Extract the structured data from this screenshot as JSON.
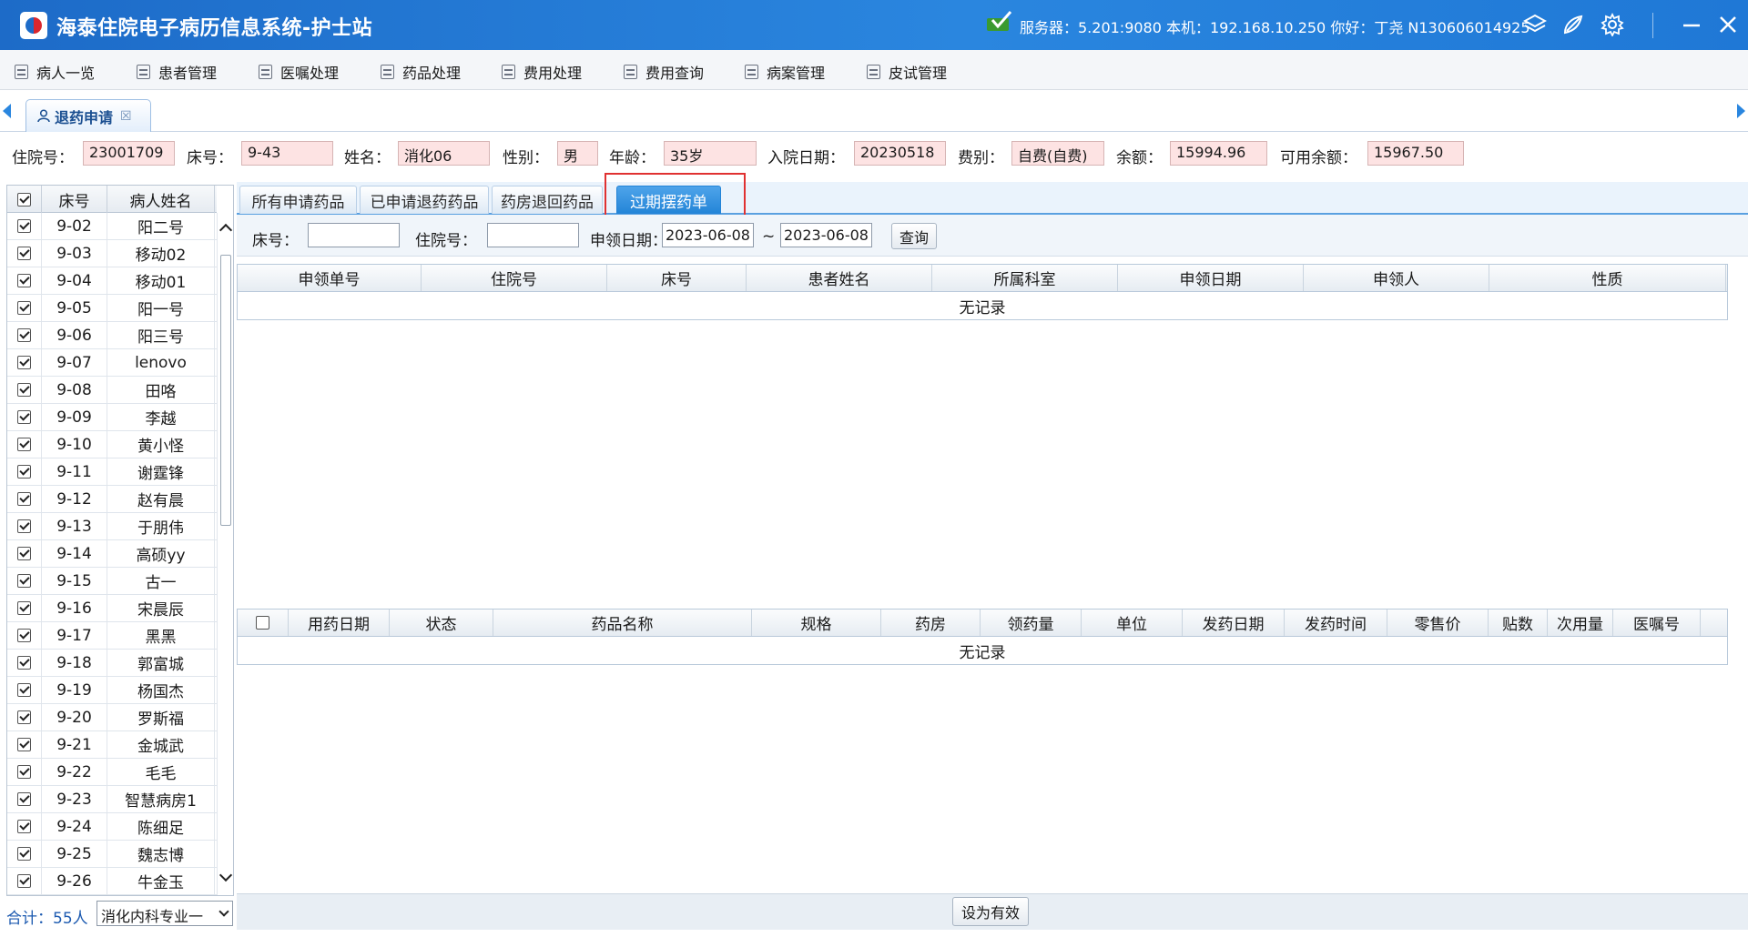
{
  "app": {
    "title": "海泰住院电子病历信息系统-护士站",
    "server_info": "服务器：5.201:9080  本机：192.168.10.250  你好：丁尧 N130606014925"
  },
  "menu": [
    {
      "label": "病人一览"
    },
    {
      "label": "患者管理"
    },
    {
      "label": "医嘱处理"
    },
    {
      "label": "药品处理"
    },
    {
      "label": "费用处理"
    },
    {
      "label": "费用查询"
    },
    {
      "label": "病案管理"
    },
    {
      "label": "皮试管理"
    }
  ],
  "doc_tab": {
    "label": "退药申请",
    "close": "☒"
  },
  "patient": {
    "admission_no_label": "住院号：",
    "admission_no": "23001709",
    "bed_label": "床号：",
    "bed": "9-43",
    "name_label": "姓名：",
    "name": "消化06",
    "gender_label": "性别：",
    "gender": "男",
    "age_label": "年龄：",
    "age": "35岁",
    "admit_date_label": "入院日期：",
    "admit_date": "20230518",
    "fee_type_label": "费别：",
    "fee_type": "自费(自费)",
    "balance_label": "余额：",
    "balance": "15994.96",
    "available_label": "可用余额：",
    "available": "15967.50"
  },
  "patient_list": {
    "headers": {
      "bed": "床号",
      "name": "病人姓名"
    },
    "rows": [
      {
        "bed": "9-02",
        "name": "阳二号"
      },
      {
        "bed": "9-03",
        "name": "移动02"
      },
      {
        "bed": "9-04",
        "name": "移动01"
      },
      {
        "bed": "9-05",
        "name": "阳一号"
      },
      {
        "bed": "9-06",
        "name": "阳三号"
      },
      {
        "bed": "9-07",
        "name": "lenovo"
      },
      {
        "bed": "9-08",
        "name": "田咯"
      },
      {
        "bed": "9-09",
        "name": "李越"
      },
      {
        "bed": "9-10",
        "name": "黄小怪"
      },
      {
        "bed": "9-11",
        "name": "谢霆锋"
      },
      {
        "bed": "9-12",
        "name": "赵有晨"
      },
      {
        "bed": "9-13",
        "name": "于朋伟"
      },
      {
        "bed": "9-14",
        "name": "高硕yy"
      },
      {
        "bed": "9-15",
        "name": "古一"
      },
      {
        "bed": "9-16",
        "name": "宋晨辰"
      },
      {
        "bed": "9-17",
        "name": "黑黑"
      },
      {
        "bed": "9-18",
        "name": "郭富城"
      },
      {
        "bed": "9-19",
        "name": "杨国杰"
      },
      {
        "bed": "9-20",
        "name": "罗斯福"
      },
      {
        "bed": "9-21",
        "name": "金城武"
      },
      {
        "bed": "9-22",
        "name": "毛毛"
      },
      {
        "bed": "9-23",
        "name": "智慧病房1"
      },
      {
        "bed": "9-24",
        "name": "陈细足"
      },
      {
        "bed": "9-25",
        "name": "魏志博"
      },
      {
        "bed": "9-26",
        "name": "牛金玉"
      }
    ],
    "total": "合计：55人",
    "dept": "消化内科专业一"
  },
  "sub_tabs": [
    {
      "label": "所有申请药品",
      "active": false
    },
    {
      "label": "已申请退药药品",
      "active": false
    },
    {
      "label": "药房退回药品",
      "active": false
    },
    {
      "label": "过期摆药单",
      "active": true
    }
  ],
  "filter": {
    "bed_label": "床号：",
    "bed_value": "",
    "admission_label": "住院号：",
    "admission_value": "",
    "date_label": "申领日期：",
    "date_from": "2023-06-08",
    "date_sep": "~",
    "date_to": "2023-06-08",
    "query_button": "查询"
  },
  "top_grid": {
    "columns": [
      "申领单号",
      "住院号",
      "床号",
      "患者姓名",
      "所属科室",
      "申领日期",
      "申领人",
      "性质"
    ],
    "empty_text": "无记录"
  },
  "bottom_grid": {
    "columns": [
      "用药日期",
      "状态",
      "药品名称",
      "规格",
      "药房",
      "领药量",
      "单位",
      "发药日期",
      "发药时间",
      "零售价",
      "贴数",
      "次用量",
      "医嘱号"
    ],
    "empty_text": "无记录"
  },
  "set_valid_button": "设为有效",
  "colors": {
    "titlebar": "#1f78d6",
    "active_tab": "#2384d7",
    "highlight": "#e03131",
    "field_bg": "#fde3e3"
  }
}
